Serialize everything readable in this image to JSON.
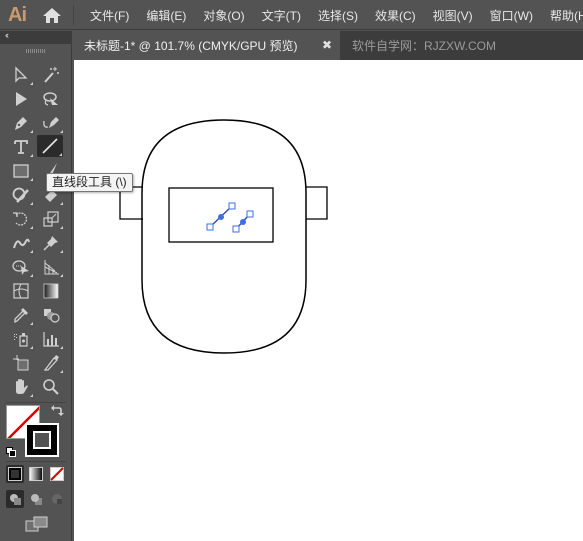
{
  "app": {
    "logo": "Ai",
    "logo_color": "#c99a6e",
    "accent_selection": "#3b6fe8"
  },
  "menu": {
    "items": [
      {
        "label": "文件(F)"
      },
      {
        "label": "编辑(E)"
      },
      {
        "label": "对象(O)"
      },
      {
        "label": "文字(T)"
      },
      {
        "label": "选择(S)"
      },
      {
        "label": "效果(C)"
      },
      {
        "label": "视图(V)"
      },
      {
        "label": "窗口(W)"
      },
      {
        "label": "帮助(H)"
      }
    ]
  },
  "tabs": {
    "active": {
      "label": "未标题-1* @ 101.7% (CMYK/GPU 预览)",
      "close": "✖"
    },
    "inactive": {
      "label": "软件自学网：RJZXW.COM"
    }
  },
  "toolbar": {
    "collapse_label": "‹‹",
    "tools": [
      {
        "name": "direct-selection-tool",
        "icon": "hollow-arrow-icon"
      },
      {
        "name": "magic-wand-tool",
        "icon": "magic-wand-icon"
      },
      {
        "name": "selection-tool",
        "icon": "arrow-icon"
      },
      {
        "name": "lasso-tool",
        "icon": "lasso-icon"
      },
      {
        "name": "pen-tool",
        "icon": "pen-icon"
      },
      {
        "name": "curvature-tool",
        "icon": "curvature-icon"
      },
      {
        "name": "type-tool",
        "icon": "type-icon",
        "glyph": "T"
      },
      {
        "name": "line-segment-tool",
        "icon": "line-icon",
        "selected": true
      },
      {
        "name": "rectangle-tool",
        "icon": "rectangle-icon"
      },
      {
        "name": "paintbrush-tool",
        "icon": "brush-icon"
      },
      {
        "name": "shaper-tool",
        "icon": "shaper-icon"
      },
      {
        "name": "eraser-tool",
        "icon": "eraser-icon"
      },
      {
        "name": "rotate-tool",
        "icon": "rotate-icon"
      },
      {
        "name": "scale-tool",
        "icon": "scale-icon"
      },
      {
        "name": "warp-tool",
        "icon": "warp-icon"
      },
      {
        "name": "puppet-warp-tool",
        "icon": "pin-icon"
      },
      {
        "name": "shape-builder-tool",
        "icon": "shape-builder-icon"
      },
      {
        "name": "perspective-grid-tool",
        "icon": "perspective-grid-icon"
      },
      {
        "name": "mesh-tool",
        "icon": "mesh-icon"
      },
      {
        "name": "gradient-tool",
        "icon": "gradient-icon"
      },
      {
        "name": "eyedropper-tool",
        "icon": "eyedropper-icon"
      },
      {
        "name": "blend-tool",
        "icon": "blend-icon"
      },
      {
        "name": "symbol-sprayer-tool",
        "icon": "symbol-sprayer-icon"
      },
      {
        "name": "column-graph-tool",
        "icon": "bar-graph-icon"
      },
      {
        "name": "artboard-tool",
        "icon": "artboard-icon"
      },
      {
        "name": "slice-tool",
        "icon": "slice-icon"
      },
      {
        "name": "hand-tool",
        "icon": "hand-icon"
      },
      {
        "name": "zoom-tool",
        "icon": "magnifier-icon"
      }
    ],
    "swap_glyph": "⤵",
    "fill": {
      "color": "none"
    },
    "stroke": {
      "color": "#000000"
    }
  },
  "tooltip": {
    "text": "直线段工具 (\\)"
  },
  "canvas": {
    "artwork": "welding-mask outline with a rectangular window and two selected line segments"
  }
}
